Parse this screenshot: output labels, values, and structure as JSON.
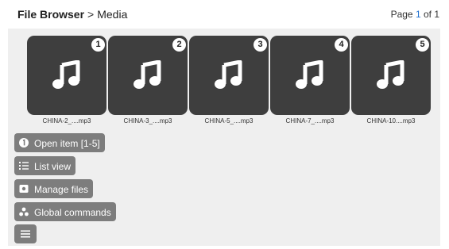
{
  "header": {
    "breadcrumb_root": "File Browser",
    "breadcrumb_sep": ">",
    "breadcrumb_current": "Media",
    "page_prefix": "Page",
    "page_current": "1",
    "page_of": "of 1"
  },
  "items": [
    {
      "number": "1",
      "name": "CHINA-2_....mp3",
      "icon": "music-note-icon"
    },
    {
      "number": "2",
      "name": "CHINA-3_....mp3",
      "icon": "music-note-icon"
    },
    {
      "number": "3",
      "name": "CHINA-5_....mp3",
      "icon": "music-note-icon"
    },
    {
      "number": "4",
      "name": "CHINA-7_....mp3",
      "icon": "music-note-icon"
    },
    {
      "number": "5",
      "name": "CHINA-10....mp3",
      "icon": "music-note-icon"
    }
  ],
  "actions": {
    "open_item": "Open item [1-5]",
    "list_view": "List view",
    "manage_files": "Manage files",
    "global_commands": "Global commands"
  },
  "colors": {
    "accent": "#1e6fd0",
    "tile": "#3e3e3e",
    "button": "#7d7d7d",
    "panel": "#efefef"
  }
}
